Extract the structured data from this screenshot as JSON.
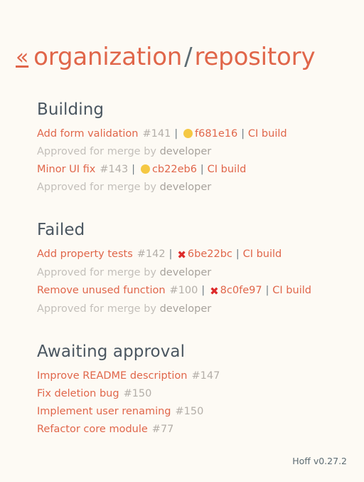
{
  "header": {
    "back_chevron": "«",
    "organization": "organization",
    "separator": "/",
    "repository": "repository"
  },
  "sections": [
    {
      "title": "Building",
      "kind": "building",
      "items": [
        {
          "title": "Add form validation",
          "number": "#141",
          "sep1": "|",
          "status_icon": "yellow-dot-icon",
          "commit": "f681e16",
          "sep2": "|",
          "ci": "CI build",
          "approval_prefix": "Approved for merge by",
          "approver": "developer"
        },
        {
          "title": "Minor UI fix",
          "number": "#143",
          "sep1": "|",
          "status_icon": "yellow-dot-icon",
          "commit": "cb22eb6",
          "sep2": "|",
          "ci": "CI build",
          "approval_prefix": "Approved for merge by",
          "approver": "developer"
        }
      ]
    },
    {
      "title": "Failed",
      "kind": "failed",
      "items": [
        {
          "title": "Add property tests",
          "number": "#142",
          "sep1": "|",
          "status_icon": "red-cross-icon",
          "status_glyph": "✖",
          "commit": "6be22bc",
          "sep2": "|",
          "ci": "CI build",
          "approval_prefix": "Approved for merge by",
          "approver": "developer"
        },
        {
          "title": "Remove unused function",
          "number": "#100",
          "sep1": "|",
          "status_icon": "red-cross-icon",
          "status_glyph": "✖",
          "commit": "8c0fe97",
          "sep2": "|",
          "ci": "CI build",
          "approval_prefix": "Approved for merge by",
          "approver": "developer"
        }
      ]
    },
    {
      "title": "Awaiting approval",
      "kind": "awaiting",
      "items": [
        {
          "title": "Improve README description",
          "number": "#147"
        },
        {
          "title": "Fix deletion bug",
          "number": "#150"
        },
        {
          "title": "Implement user renaming",
          "number": "#150"
        },
        {
          "title": "Refactor core module",
          "number": "#77"
        }
      ]
    }
  ],
  "footer": {
    "version_text": "Hoff v0.27.2"
  },
  "colors": {
    "background": "#fdfaf4",
    "accent_link": "#e0664a",
    "heading": "#4a5660",
    "muted": "#b3aea8",
    "status_building": "#f5c843",
    "status_failed": "#dd2b2b"
  }
}
